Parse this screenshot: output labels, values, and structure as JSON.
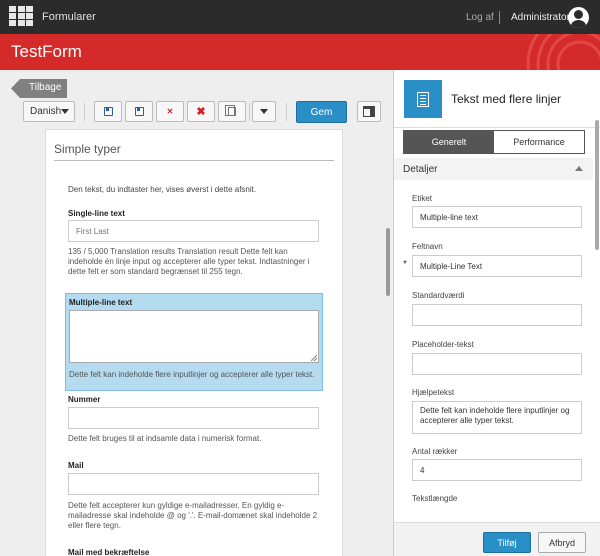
{
  "topbar": {
    "app_name": "Formularer",
    "logoff": "Log af",
    "user": "Administrator"
  },
  "header": {
    "title": "TestForm"
  },
  "toolbar": {
    "back_label": "Tilbage",
    "language": "Danish",
    "save_label": "Gem"
  },
  "form": {
    "section_title": "Simple typer",
    "intro": "Den tekst, du indtaster her, vises øverst i dette afsnit.",
    "fields": [
      {
        "label": "Single-line text",
        "placeholder": "First Last",
        "help": "135 / 5,000 Translation results Translation result Dette felt kan indeholde én linje input og accepterer alle typer tekst. Indtastninger i dette felt er som standard begrænset til 255 tegn."
      },
      {
        "label": "Multiple-line text",
        "help": "Dette felt kan indeholde flere inputlinjer og accepterer alle typer tekst."
      },
      {
        "label": "Nummer",
        "help": "Dette felt bruges til at indsamle data i numerisk format."
      },
      {
        "label": "Mail",
        "help": "Dette felt accepterer kun gyldige e-mailadresser. En gyldig e-mailadresse skal indeholde @ og '.'. E-mail-domænet skal indeholde 2 eller flere tegn."
      },
      {
        "label": "Mail med bekræftelse"
      }
    ]
  },
  "panel": {
    "title": "Tekst med flere linjer",
    "tabs": [
      "Generelt",
      "Performance"
    ],
    "section": "Detaljer",
    "props": [
      {
        "label": "Etiket",
        "value": "Multiple-line text"
      },
      {
        "label": "Feltnavn",
        "value": "Multiple-Line Text",
        "required_mark": "*"
      },
      {
        "label": "Standardværdi",
        "value": ""
      },
      {
        "label": "Placeholder-tekst",
        "value": ""
      },
      {
        "label": "Hjælpetekst",
        "value": "Dette felt kan indeholde flere inputlinjer og accepterer alle typer tekst."
      },
      {
        "label": "Antal rækker",
        "value": "4"
      },
      {
        "label": "Tekstlængde"
      }
    ],
    "add_label": "Tilføj",
    "cancel_label": "Afbryd"
  },
  "colors": {
    "accent": "#2a8ec7",
    "brand_red": "#d42a2a",
    "topbar": "#2b2b2b",
    "selection": "#b4dbef"
  }
}
